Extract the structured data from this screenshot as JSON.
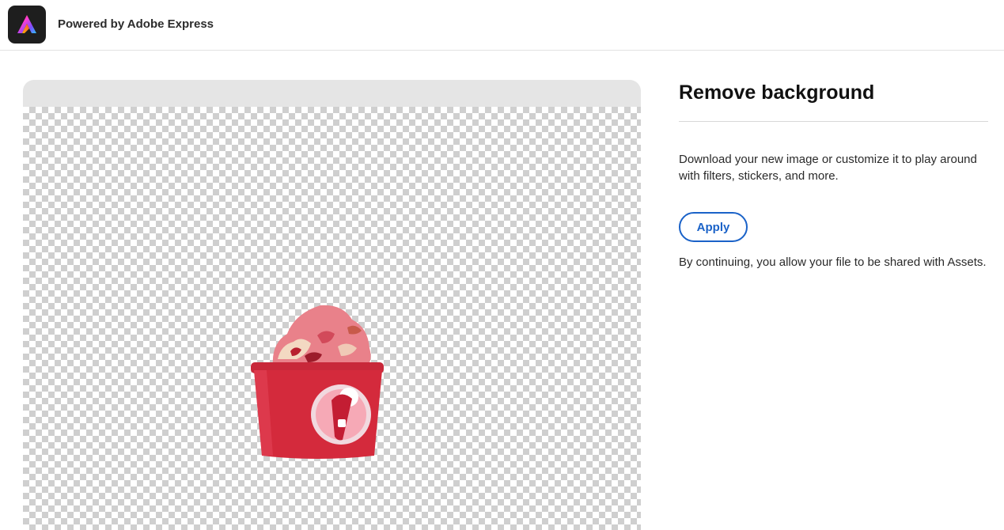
{
  "header": {
    "powered_by": "Powered by Adobe Express",
    "logo_icon": "adobe-express-logo"
  },
  "canvas": {
    "background": "transparent-checkerboard",
    "image_subject": "ice-cream-cup-icon"
  },
  "panel": {
    "title": "Remove background",
    "description": "Download your new image or customize it to play around with filters, stickers, and more.",
    "apply_label": "Apply",
    "consent": "By continuing, you allow your file to be shared with Assets."
  },
  "colors": {
    "accent": "#1a62c8",
    "cup_red": "#d42a3c"
  }
}
